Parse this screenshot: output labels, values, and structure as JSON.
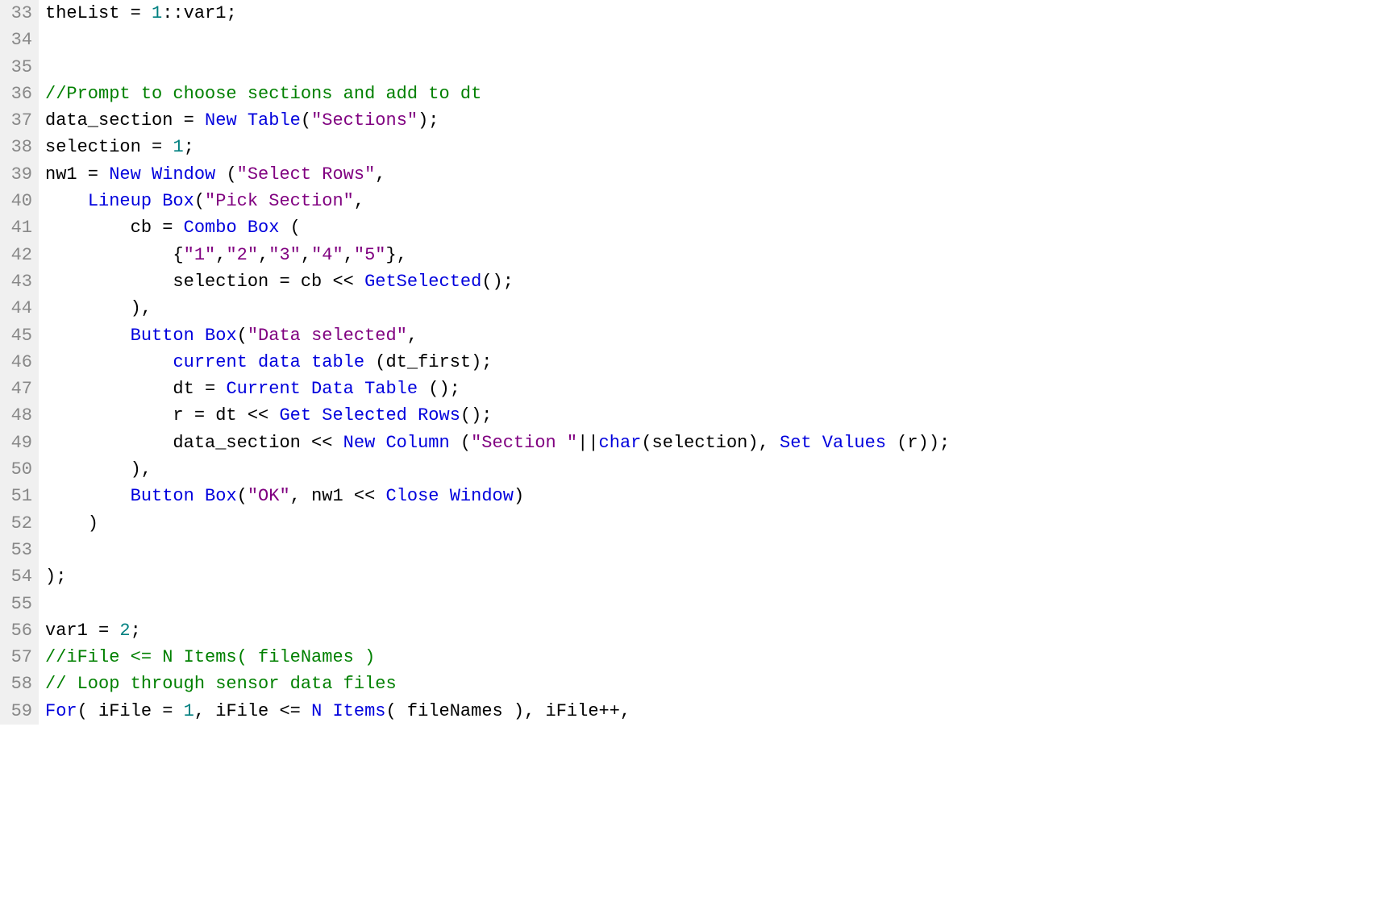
{
  "lines": [
    {
      "num": 33,
      "tokens": [
        {
          "t": "theList = ",
          "c": "id"
        },
        {
          "t": "1",
          "c": "num"
        },
        {
          "t": "::var1;",
          "c": "id"
        }
      ]
    },
    {
      "num": 34,
      "tokens": []
    },
    {
      "num": 35,
      "tokens": []
    },
    {
      "num": 36,
      "tokens": [
        {
          "t": "//Prompt to choose sections and add to dt",
          "c": "cmt"
        }
      ]
    },
    {
      "num": 37,
      "tokens": [
        {
          "t": "data_section = ",
          "c": "id"
        },
        {
          "t": "New Table",
          "c": "kw"
        },
        {
          "t": "(",
          "c": "id"
        },
        {
          "t": "\"Sections\"",
          "c": "str"
        },
        {
          "t": ");",
          "c": "id"
        }
      ]
    },
    {
      "num": 38,
      "tokens": [
        {
          "t": "selection = ",
          "c": "id"
        },
        {
          "t": "1",
          "c": "num"
        },
        {
          "t": ";",
          "c": "id"
        }
      ]
    },
    {
      "num": 39,
      "tokens": [
        {
          "t": "nw1 = ",
          "c": "id"
        },
        {
          "t": "New Window",
          "c": "kw"
        },
        {
          "t": " (",
          "c": "id"
        },
        {
          "t": "\"Select Rows\"",
          "c": "str"
        },
        {
          "t": ",",
          "c": "id"
        }
      ]
    },
    {
      "num": 40,
      "tokens": [
        {
          "t": "    ",
          "c": "id"
        },
        {
          "t": "Lineup Box",
          "c": "kw"
        },
        {
          "t": "(",
          "c": "id"
        },
        {
          "t": "\"Pick Section\"",
          "c": "str"
        },
        {
          "t": ",",
          "c": "id"
        }
      ]
    },
    {
      "num": 41,
      "tokens": [
        {
          "t": "        cb = ",
          "c": "id"
        },
        {
          "t": "Combo Box",
          "c": "kw"
        },
        {
          "t": " (",
          "c": "id"
        }
      ]
    },
    {
      "num": 42,
      "tokens": [
        {
          "t": "            {",
          "c": "id"
        },
        {
          "t": "\"1\"",
          "c": "str"
        },
        {
          "t": ",",
          "c": "id"
        },
        {
          "t": "\"2\"",
          "c": "str"
        },
        {
          "t": ",",
          "c": "id"
        },
        {
          "t": "\"3\"",
          "c": "str"
        },
        {
          "t": ",",
          "c": "id"
        },
        {
          "t": "\"4\"",
          "c": "str"
        },
        {
          "t": ",",
          "c": "id"
        },
        {
          "t": "\"5\"",
          "c": "str"
        },
        {
          "t": "},",
          "c": "id"
        }
      ]
    },
    {
      "num": 43,
      "tokens": [
        {
          "t": "            selection = cb << ",
          "c": "id"
        },
        {
          "t": "GetSelected",
          "c": "kw"
        },
        {
          "t": "();",
          "c": "id"
        }
      ]
    },
    {
      "num": 44,
      "tokens": [
        {
          "t": "        ),",
          "c": "id"
        }
      ]
    },
    {
      "num": 45,
      "tokens": [
        {
          "t": "        ",
          "c": "id"
        },
        {
          "t": "Button Box",
          "c": "kw"
        },
        {
          "t": "(",
          "c": "id"
        },
        {
          "t": "\"Data selected\"",
          "c": "str"
        },
        {
          "t": ",",
          "c": "id"
        }
      ]
    },
    {
      "num": 46,
      "tokens": [
        {
          "t": "            ",
          "c": "id"
        },
        {
          "t": "current data table",
          "c": "kw"
        },
        {
          "t": " (dt_first);",
          "c": "id"
        }
      ]
    },
    {
      "num": 47,
      "tokens": [
        {
          "t": "            dt = ",
          "c": "id"
        },
        {
          "t": "Current Data Table",
          "c": "kw"
        },
        {
          "t": " ();",
          "c": "id"
        }
      ]
    },
    {
      "num": 48,
      "tokens": [
        {
          "t": "            r = dt << ",
          "c": "id"
        },
        {
          "t": "Get Selected Rows",
          "c": "kw"
        },
        {
          "t": "();",
          "c": "id"
        }
      ]
    },
    {
      "num": 49,
      "tokens": [
        {
          "t": "            data_section << ",
          "c": "id"
        },
        {
          "t": "New Column",
          "c": "kw"
        },
        {
          "t": " (",
          "c": "id"
        },
        {
          "t": "\"Section \"",
          "c": "str"
        },
        {
          "t": "||",
          "c": "id"
        },
        {
          "t": "char",
          "c": "kw"
        },
        {
          "t": "(selection), ",
          "c": "id"
        },
        {
          "t": "Set Values",
          "c": "kw"
        },
        {
          "t": " (r));",
          "c": "id"
        }
      ]
    },
    {
      "num": 50,
      "tokens": [
        {
          "t": "        ),",
          "c": "id"
        }
      ]
    },
    {
      "num": 51,
      "tokens": [
        {
          "t": "        ",
          "c": "id"
        },
        {
          "t": "Button Box",
          "c": "kw"
        },
        {
          "t": "(",
          "c": "id"
        },
        {
          "t": "\"OK\"",
          "c": "str"
        },
        {
          "t": ", nw1 << ",
          "c": "id"
        },
        {
          "t": "Close Window",
          "c": "kw"
        },
        {
          "t": ")",
          "c": "id"
        }
      ]
    },
    {
      "num": 52,
      "tokens": [
        {
          "t": "    )",
          "c": "id"
        }
      ]
    },
    {
      "num": 53,
      "tokens": []
    },
    {
      "num": 54,
      "tokens": [
        {
          "t": ");",
          "c": "id"
        }
      ]
    },
    {
      "num": 55,
      "tokens": []
    },
    {
      "num": 56,
      "tokens": [
        {
          "t": "var1 = ",
          "c": "id"
        },
        {
          "t": "2",
          "c": "num"
        },
        {
          "t": ";",
          "c": "id"
        }
      ]
    },
    {
      "num": 57,
      "tokens": [
        {
          "t": "//iFile <= N Items( fileNames )",
          "c": "cmt"
        }
      ]
    },
    {
      "num": 58,
      "tokens": [
        {
          "t": "// Loop through sensor data files",
          "c": "cmt"
        }
      ]
    },
    {
      "num": 59,
      "tokens": [
        {
          "t": "For",
          "c": "kw"
        },
        {
          "t": "( iFile = ",
          "c": "id"
        },
        {
          "t": "1",
          "c": "num"
        },
        {
          "t": ", iFile <= ",
          "c": "id"
        },
        {
          "t": "N Items",
          "c": "kw"
        },
        {
          "t": "( fileNames ), iFile++,",
          "c": "id"
        }
      ]
    }
  ]
}
